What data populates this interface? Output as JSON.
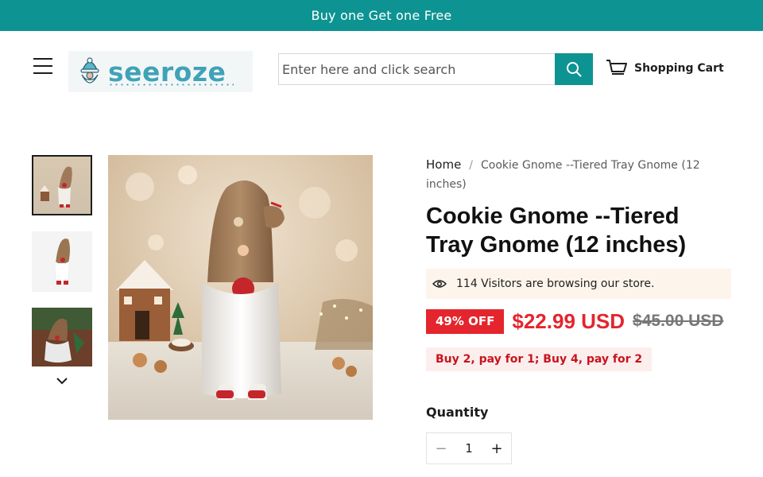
{
  "announcement": {
    "text": "Buy one Get one Free"
  },
  "header": {
    "logo_text": "seeroze",
    "search": {
      "placeholder": "Enter here and click search"
    },
    "cart_label": "Shopping Cart"
  },
  "gallery": {
    "thumbnails": [
      "thumb-1",
      "thumb-2",
      "thumb-3"
    ],
    "active_index": 0
  },
  "product": {
    "breadcrumb": {
      "home": "Home",
      "separator": "/",
      "current": "Cookie Gnome --Tiered Tray Gnome (12 inches)"
    },
    "title": "Cookie Gnome --Tiered Tray Gnome (12 inches)",
    "visitors_text": "114 Visitors are browsing our store.",
    "discount_badge": "49% OFF",
    "sale_price": "$22.99 USD",
    "compare_price": "$45.00 USD",
    "promo_text": "Buy 2, pay for 1; Buy 4, pay for 2",
    "quantity_label": "Quantity",
    "quantity_value": "1",
    "minus_label": "−",
    "plus_label": "+"
  },
  "colors": {
    "brand_teal": "#0e9393",
    "sale_red": "#e4252d",
    "visitors_bg": "#fdf4ec",
    "promo_bg": "#fdeeee"
  },
  "icons": [
    "menu-icon",
    "search-icon",
    "cart-icon",
    "eye-icon",
    "chevron-down-icon",
    "gnome-logo-icon"
  ]
}
